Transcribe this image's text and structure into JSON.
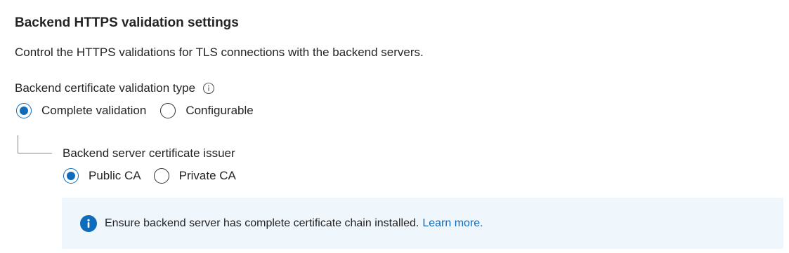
{
  "section": {
    "title": "Backend HTTPS validation settings",
    "description": "Control the HTTPS validations for TLS connections with the backend servers."
  },
  "validation_type": {
    "label": "Backend certificate validation type",
    "info_icon": "info-icon",
    "options": [
      {
        "label": "Complete validation",
        "selected": true
      },
      {
        "label": "Configurable",
        "selected": false
      }
    ]
  },
  "issuer": {
    "label": "Backend server certificate issuer",
    "options": [
      {
        "label": "Public CA",
        "selected": true
      },
      {
        "label": "Private CA",
        "selected": false
      }
    ]
  },
  "info_bar": {
    "icon": "info-filled-icon",
    "message": "Ensure backend server has complete certificate chain installed.",
    "link_text": "Learn more."
  },
  "colors": {
    "accent": "#0f6cbd",
    "info_background": "#eff6fc",
    "text": "#242424"
  }
}
